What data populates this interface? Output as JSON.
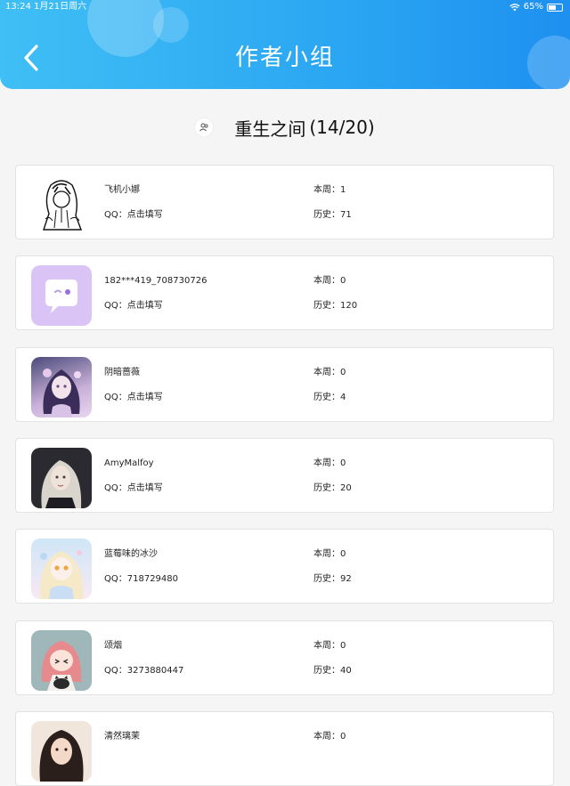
{
  "status_bar": {
    "time": "13:24",
    "date": "1月21日周六",
    "battery": "65%",
    "battery_level": 0.65,
    "wifi_icon": "wifi-icon"
  },
  "header": {
    "title": "作者小组",
    "back_icon": "chevron-left-icon",
    "gradient": [
      "#3fbff5",
      "#1e90f0"
    ]
  },
  "group": {
    "icon": "group-icon",
    "name": "重生之间",
    "count": "(14/20)"
  },
  "members": [
    {
      "name": "飞机小娜",
      "qq_label": "QQ：",
      "qq": "点击填写",
      "week_label": "本周：",
      "week": "1",
      "history_label": "历史：",
      "history": "71",
      "avatar": "sketch-girl-avatar"
    },
    {
      "name": "182***419_708730726",
      "qq_label": "QQ：",
      "qq": "点击填写",
      "week_label": "本周：",
      "week": "0",
      "history_label": "历史：",
      "history": "120",
      "avatar": "default-chat-avatar"
    },
    {
      "name": "阴暗蔷薇",
      "qq_label": "QQ：",
      "qq": "点击填写",
      "week_label": "本周：",
      "week": "0",
      "history_label": "历史：",
      "history": "4",
      "avatar": "anime-purple-girl-avatar"
    },
    {
      "name": "AmyMalfoy",
      "qq_label": "QQ：",
      "qq": "点击填写",
      "week_label": "本周：",
      "week": "0",
      "history_label": "历史：",
      "history": "20",
      "avatar": "blonde-girl-avatar"
    },
    {
      "name": "蓝莓味的冰沙",
      "qq_label": "QQ：",
      "qq": "718729480",
      "week_label": "本周：",
      "week": "0",
      "history_label": "历史：",
      "history": "92",
      "avatar": "pastel-anime-avatar"
    },
    {
      "name": "颂烟",
      "qq_label": "QQ：",
      "qq": "3273880447",
      "week_label": "本周：",
      "week": "0",
      "history_label": "历史：",
      "history": "40",
      "avatar": "pink-hair-girl-cat-avatar"
    },
    {
      "name": "清然璃茉",
      "qq_label": "",
      "qq": "",
      "week_label": "本周：",
      "week": "0",
      "history_label": "",
      "history": "",
      "avatar": "dark-hair-girl-avatar"
    }
  ]
}
